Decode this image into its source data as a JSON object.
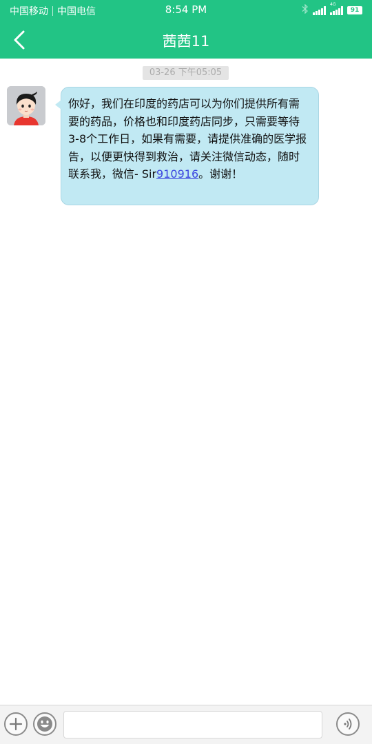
{
  "status_bar": {
    "carrier1": "中国移动",
    "carrier2": "中国电信",
    "time": "8:54 PM",
    "battery": "91",
    "network_badge": "4G"
  },
  "header": {
    "title": "茜茜11"
  },
  "conversation": {
    "timestamp": "03-26 下午05:05",
    "message": {
      "text_before_link": "你好，我们在印度的药店可以为你们提供所有需要的药品，价格也和印度药店同步，只需要等待3-8个工作日，如果有需要，请提供准确的医学报告，以便更快得到救治，请关注微信动态，随时联系我，微信- Sir",
      "link_text": "910916",
      "text_after_link": "。谢谢！"
    }
  },
  "input_bar": {
    "placeholder": ""
  },
  "colors": {
    "accent": "#22c485",
    "bubble": "#c1e9f3",
    "link": "#3b46e0"
  },
  "icons": [
    "back-arrow-icon",
    "bluetooth-icon",
    "signal-icon",
    "battery-icon",
    "plus-icon",
    "emoji-icon",
    "voice-icon",
    "avatar"
  ]
}
